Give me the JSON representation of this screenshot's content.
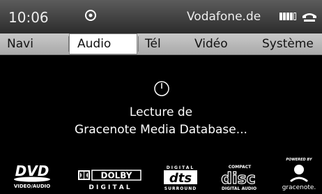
{
  "status_bar": {
    "time": "10:06",
    "media_icon": "disc-icon",
    "operator": "Vodafone.de",
    "signal_bars_filled": 4,
    "signal_bars_total": 5,
    "phone_icon": "handset-icon"
  },
  "menu": {
    "items": [
      {
        "label": "Navi",
        "selected": false
      },
      {
        "label": "Audio",
        "selected": true
      },
      {
        "label": "Tél",
        "selected": false
      },
      {
        "label": "Vidéo",
        "selected": false
      },
      {
        "label": "Système",
        "selected": false
      }
    ]
  },
  "main": {
    "status_icon": "clock-icon",
    "message_line1": "Lecture de",
    "message_line2": "Gracenote Media Database..."
  },
  "logos": {
    "dvd": {
      "name": "DVD",
      "caption": "VIDEO/AUDIO"
    },
    "dolby": {
      "name": "DOLBY",
      "caption": "D I G I T A L"
    },
    "dts": {
      "name": "dts",
      "top": "DIGITAL",
      "caption": "SURROUND"
    },
    "cd": {
      "name": "disc",
      "top": "COMPACT",
      "caption": "DIGITAL AUDIO"
    },
    "gracenote": {
      "top": "POWERED BY",
      "caption": "gracenote."
    }
  },
  "colors": {
    "background": "#000000",
    "menu_bar": "#b8b8b8",
    "selected_tab": "#ffffff"
  }
}
